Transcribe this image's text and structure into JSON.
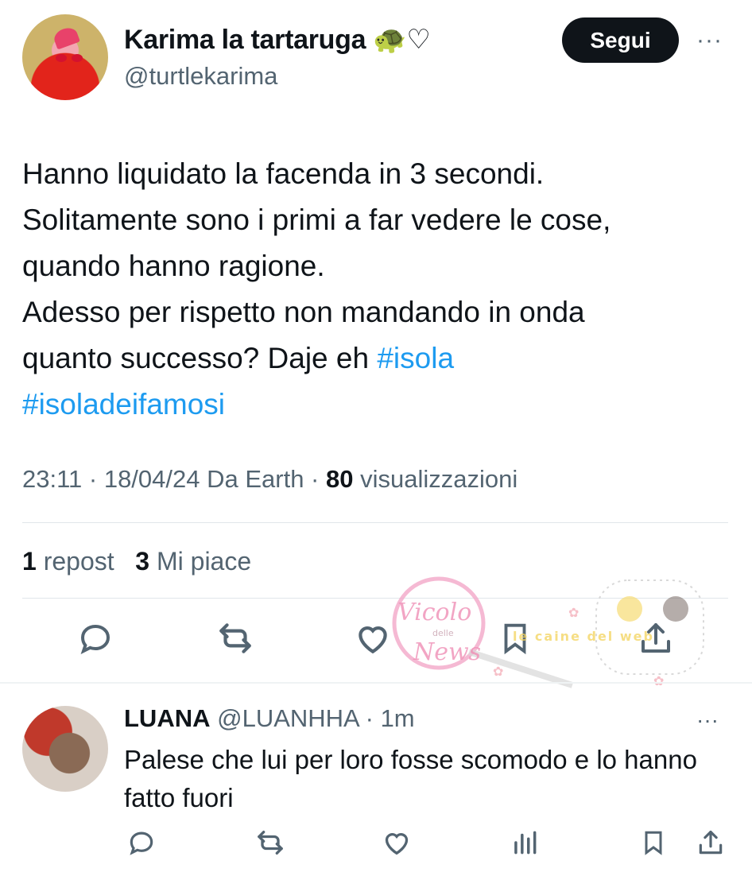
{
  "tweet": {
    "author_name": "Karima la tartaruga 🐢♡",
    "author_handle": "@turtlekarima",
    "follow_label": "Segui",
    "more_label": "···",
    "text_lines": [
      "Hanno liquidato la facenda in 3 secondi.",
      "Solitamente sono i primi a far vedere le cose,",
      "quando hanno ragione.",
      "Adesso per rispetto non mandando in onda",
      "quanto successo? Daje eh "
    ],
    "hashtag_1": "#isola",
    "hashtag_2": "#isoladeifamosi",
    "meta_time": "23:11 · 18/04/24 Da Earth · ",
    "views_count": "80",
    "views_label": " visualizzazioni",
    "reposts_count": "1",
    "reposts_label": " repost",
    "likes_count": "3",
    "likes_label": " Mi piace"
  },
  "reply": {
    "author_name": "LUANA",
    "author_handle": " @LUANHHA · 1m",
    "more_label": "···",
    "text": "Palese che lui per loro fosse scomodo e lo hanno fatto fuori"
  },
  "watermark": {
    "brand_line1": "Vicolo",
    "brand_line2": "delle",
    "brand_line3": "News",
    "brand_tag": "le caine del web"
  },
  "colors": {
    "text": "#0f1419",
    "secondary": "#536471",
    "hashtag": "#1d9bf0",
    "follow_bg": "#0f1419"
  },
  "icons": [
    "reply-icon",
    "repost-icon",
    "like-icon",
    "bookmark-icon",
    "share-icon",
    "views-icon",
    "more-icon"
  ]
}
